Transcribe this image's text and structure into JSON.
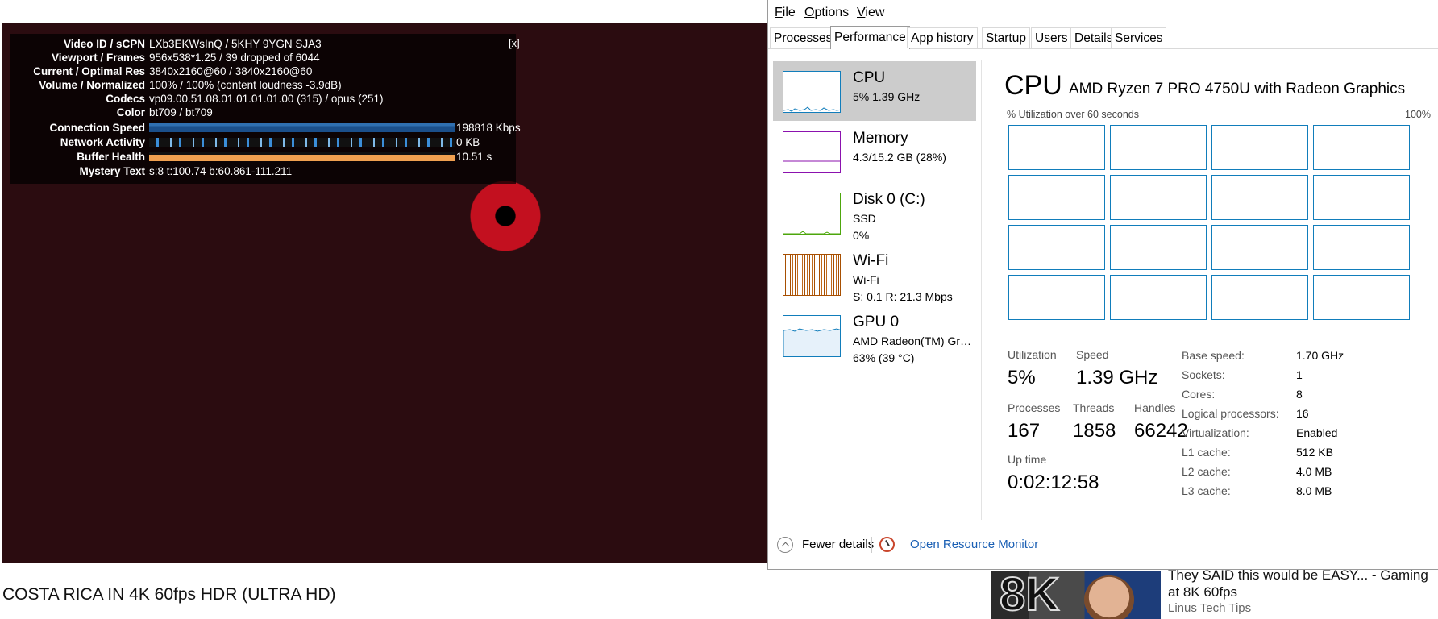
{
  "video": {
    "title": "COSTA RICA IN 4K 60fps HDR (ULTRA HD)",
    "stats": {
      "close": "[x]",
      "rows": [
        {
          "label": "Video ID / sCPN",
          "value": "LXb3EKWsInQ / 5KHY 9YGN SJA3"
        },
        {
          "label": "Viewport / Frames",
          "value": "956x538*1.25 / 39 dropped of 6044"
        },
        {
          "label": "Current / Optimal Res",
          "value": "3840x2160@60 / 3840x2160@60"
        },
        {
          "label": "Volume / Normalized",
          "value": "100% / 100% (content loudness -3.9dB)"
        },
        {
          "label": "Codecs",
          "value": "vp09.00.51.08.01.01.01.01.00 (315) / opus (251)"
        },
        {
          "label": "Color",
          "value": "bt709 / bt709"
        },
        {
          "label": "Connection Speed",
          "value": "198818 Kbps"
        },
        {
          "label": "Network Activity",
          "value": "0 KB"
        },
        {
          "label": "Buffer Health",
          "value": "10.51 s"
        },
        {
          "label": "Mystery Text",
          "value": "s:8 t:100.74 b:60.861-111.211"
        }
      ]
    }
  },
  "recommended": {
    "thumb_text": "8K",
    "title": "They SAID this would be EASY... - Gaming at 8K 60fps",
    "channel": "Linus Tech Tips"
  },
  "taskmanager": {
    "menu": [
      {
        "key": "F",
        "rest": "ile"
      },
      {
        "key": "O",
        "rest": "ptions"
      },
      {
        "key": "V",
        "rest": "iew"
      }
    ],
    "tabs": [
      "Processes",
      "Performance",
      "App history",
      "Startup",
      "Users",
      "Details",
      "Services"
    ],
    "active_tab": "Performance",
    "side": [
      {
        "name": "CPU",
        "sub": "5%  1.39 GHz",
        "sub2": "",
        "color": "#117dbb"
      },
      {
        "name": "Memory",
        "sub": "4.3/15.2 GB (28%)",
        "sub2": "",
        "color": "#8b12ae"
      },
      {
        "name": "Disk 0 (C:)",
        "sub": "SSD",
        "sub2": "0%",
        "color": "#4da60c"
      },
      {
        "name": "Wi-Fi",
        "sub": "Wi-Fi",
        "sub2": "S: 0.1  R: 21.3 Mbps",
        "color": "#a74f01"
      },
      {
        "name": "GPU 0",
        "sub": "AMD Radeon(TM) Graphics",
        "sub2": "63%  (39 °C)",
        "color": "#117dbb"
      }
    ],
    "cpu": {
      "title": "CPU",
      "model": "AMD Ryzen 7 PRO 4750U with Radeon Graphics",
      "util_label": "% Utilization over 60 seconds",
      "util_max": "100%",
      "utilization_label": "Utilization",
      "utilization": "5%",
      "speed_label": "Speed",
      "speed": "1.39 GHz",
      "processes_label": "Processes",
      "processes": "167",
      "threads_label": "Threads",
      "threads": "1858",
      "handles_label": "Handles",
      "handles": "66242",
      "uptime_label": "Up time",
      "uptime": "0:02:12:58",
      "specs": [
        {
          "k": "Base speed:",
          "v": "1.70 GHz"
        },
        {
          "k": "Sockets:",
          "v": "1"
        },
        {
          "k": "Cores:",
          "v": "8"
        },
        {
          "k": "Logical processors:",
          "v": "16"
        },
        {
          "k": "Virtualization:",
          "v": "Enabled"
        },
        {
          "k": "L1 cache:",
          "v": "512 KB"
        },
        {
          "k": "L2 cache:",
          "v": "4.0 MB"
        },
        {
          "k": "L3 cache:",
          "v": "8.0 MB"
        }
      ]
    },
    "footer": {
      "fewer_details": "Fewer details",
      "open_monitor": "Open Resource Monitor"
    }
  }
}
